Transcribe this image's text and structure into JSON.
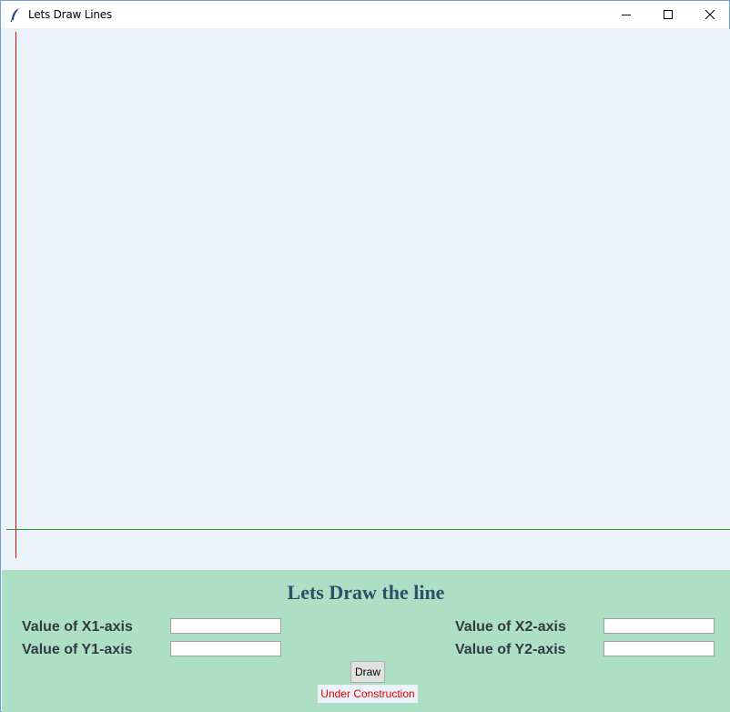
{
  "window": {
    "title": "Lets Draw Lines",
    "controls": [
      "minimize",
      "maximize",
      "close"
    ]
  },
  "canvas": {
    "background": "#ebf2fa",
    "y_axis_color": "#e01010",
    "x_axis_color": "#2c8a2c"
  },
  "panel": {
    "background": "#addfc4",
    "heading": "Lets Draw the line",
    "x1_label": "Value of X1-axis",
    "y1_label": "Value of Y1-axis",
    "x2_label": "Value of X2-axis",
    "y2_label": "Value of Y2-axis",
    "x1_value": "",
    "y1_value": "",
    "x2_value": "",
    "y2_value": "",
    "draw_label": "Draw",
    "status_text": "Under Construction"
  }
}
